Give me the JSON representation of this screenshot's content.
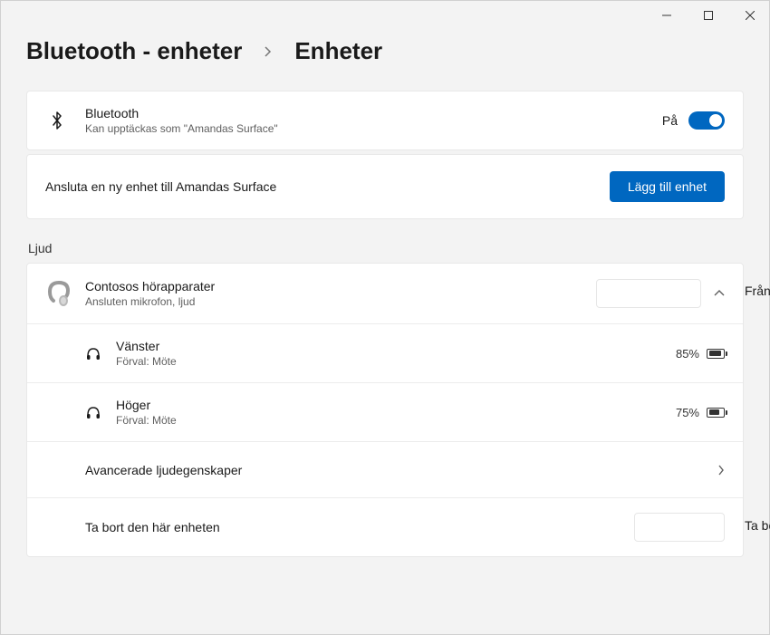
{
  "breadcrumb": {
    "root": "Bluetooth - enheter",
    "current": "Enheter"
  },
  "bluetooth": {
    "title": "Bluetooth",
    "subtitle": "Kan upptäckas som \"Amandas Surface\"",
    "state_label": "På"
  },
  "add": {
    "text": "Ansluta en ny enhet till Amandas Surface",
    "button": "Lägg till enhet"
  },
  "section_audio": "Ljud",
  "device": {
    "name": "Contosos hörapparater",
    "status": "Ansluten mikrofon, ljud",
    "disconnect": "Frånkoppla"
  },
  "left": {
    "label": "Vänster",
    "preset": "Förval: Möte",
    "battery": "85%"
  },
  "right": {
    "label": "Höger",
    "preset": "Förval: Möte",
    "battery": "75%"
  },
  "advanced": "Avancerade ljudegenskaper",
  "remove": {
    "label": "Ta bort den här enheten",
    "action": "Ta bort"
  }
}
